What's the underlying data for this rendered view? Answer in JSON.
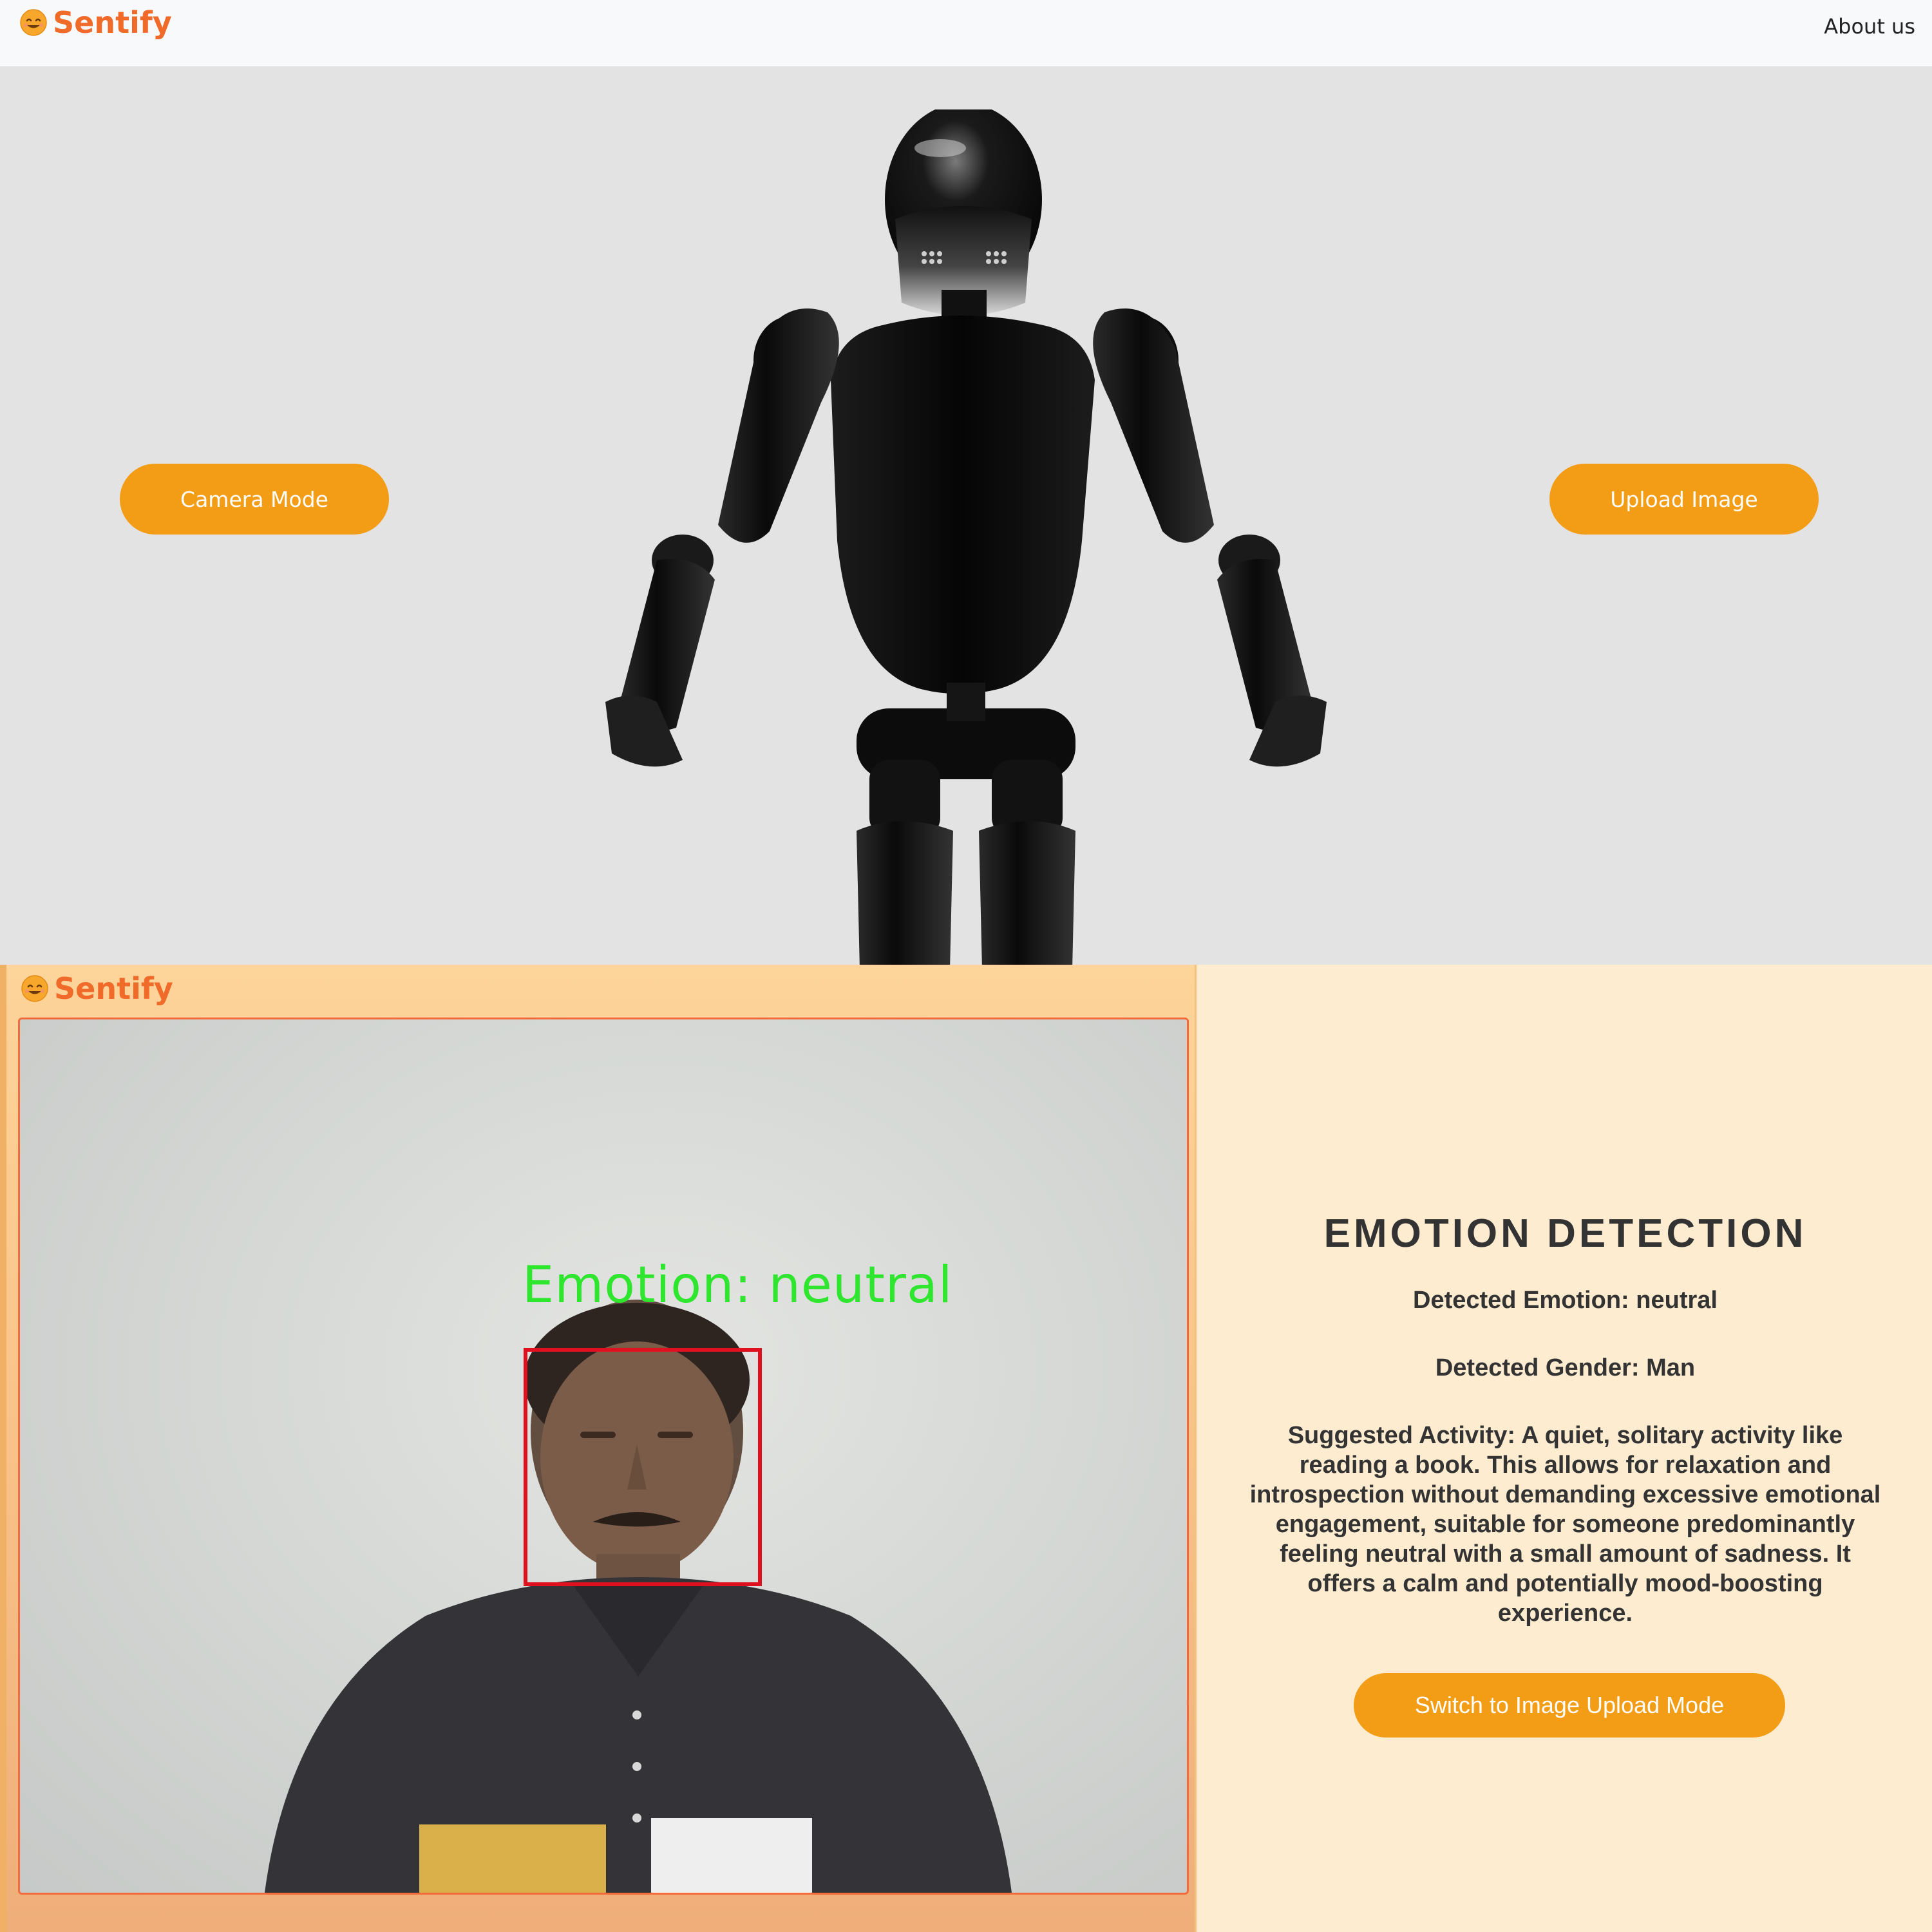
{
  "landing": {
    "brand": {
      "name": "Sentify",
      "icon": "smiley-icon"
    },
    "nav": {
      "about_label": "About us"
    },
    "buttons": {
      "camera_mode_label": "Camera Mode",
      "upload_image_label": "Upload Image"
    },
    "hero_image": "humanoid-robot"
  },
  "camera_view": {
    "brand": {
      "name": "Sentify",
      "icon": "smiley-icon"
    },
    "overlay_text": "Emotion: neutral"
  },
  "results": {
    "title": "EMOTION DETECTION",
    "detected_emotion": "Detected Emotion: neutral",
    "detected_gender": "Detected Gender: Man",
    "suggested_activity": "Suggested Activity: A quiet, solitary activity like reading a book. This allows for relaxation and introspection without demanding excessive emotional engagement, suitable for someone predominantly feeling neutral with a small amount of sadness. It offers a calm and potentially mood-boosting experience.",
    "switch_button_label": "Switch to Image Upload Mode"
  },
  "colors": {
    "accent": "#f39c16",
    "brand": "#f06a2a",
    "overlay_green": "#2ee62e",
    "face_box_red": "#e01020",
    "results_bg": "#feecd0",
    "landing_bg": "#e3e3e3"
  }
}
